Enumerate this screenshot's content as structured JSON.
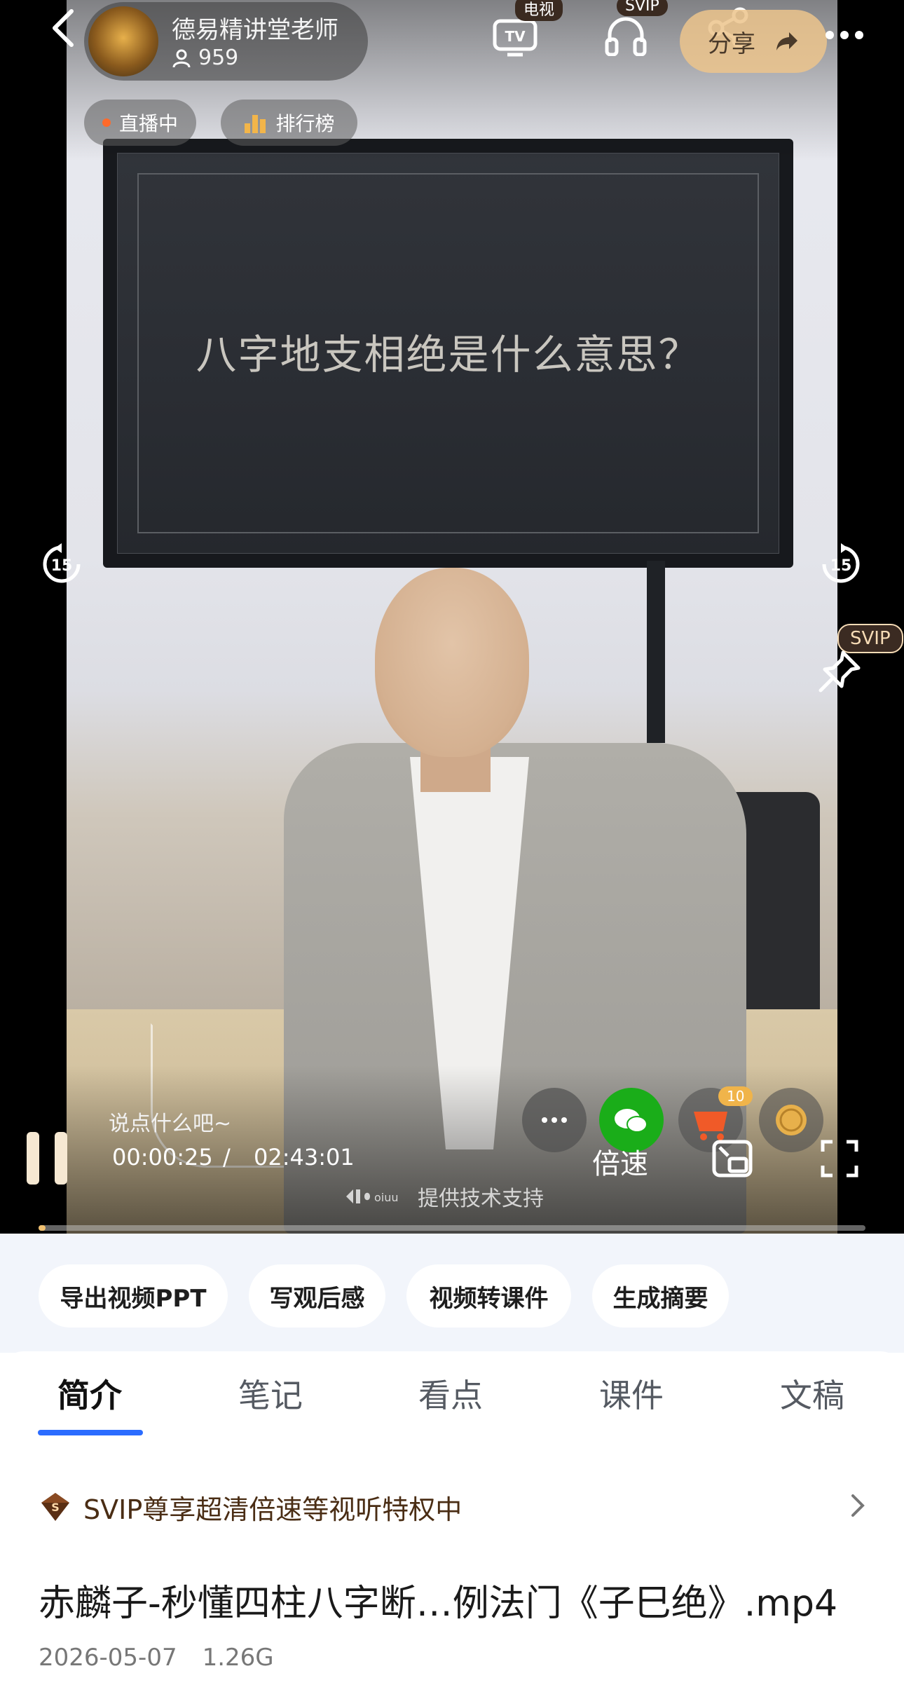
{
  "host": {
    "name": "德易精讲堂老师",
    "viewers": "959"
  },
  "top_bar": {
    "tv_badge": "电视",
    "svip_badge": "SVIP",
    "share_label": "分享"
  },
  "chips": {
    "live": "直播中",
    "ranking": "排行榜"
  },
  "video": {
    "screen_text": "八字地支相绝是什么意思？",
    "skip_back": "15",
    "skip_forward": "15",
    "pin_badge": "SVIP",
    "comment_placeholder": "说点什么吧~",
    "current_time": "00:00:25",
    "separator": "/",
    "total_time": "02:43:01",
    "speed_label": "倍速",
    "cart_count": "10",
    "tech_support": "提供技术支持",
    "progress_fraction": 0.0026
  },
  "actions": [
    "导出视频PPT",
    "写观后感",
    "视频转课件",
    "生成摘要"
  ],
  "tabs": [
    "简介",
    "笔记",
    "看点",
    "课件",
    "文稿"
  ],
  "active_tab": "简介",
  "svip_promo": "SVIP尊享超清倍速等视听特权中",
  "file": {
    "name": "赤麟子-秒懂四柱八字断…例法门《子巳绝》.mp4",
    "date": "2026-05-07",
    "size": "1.26G"
  },
  "colors": {
    "accent": "#2b6cff",
    "svip_gold": "#f0c070",
    "svip_brown": "#4a2d14"
  }
}
